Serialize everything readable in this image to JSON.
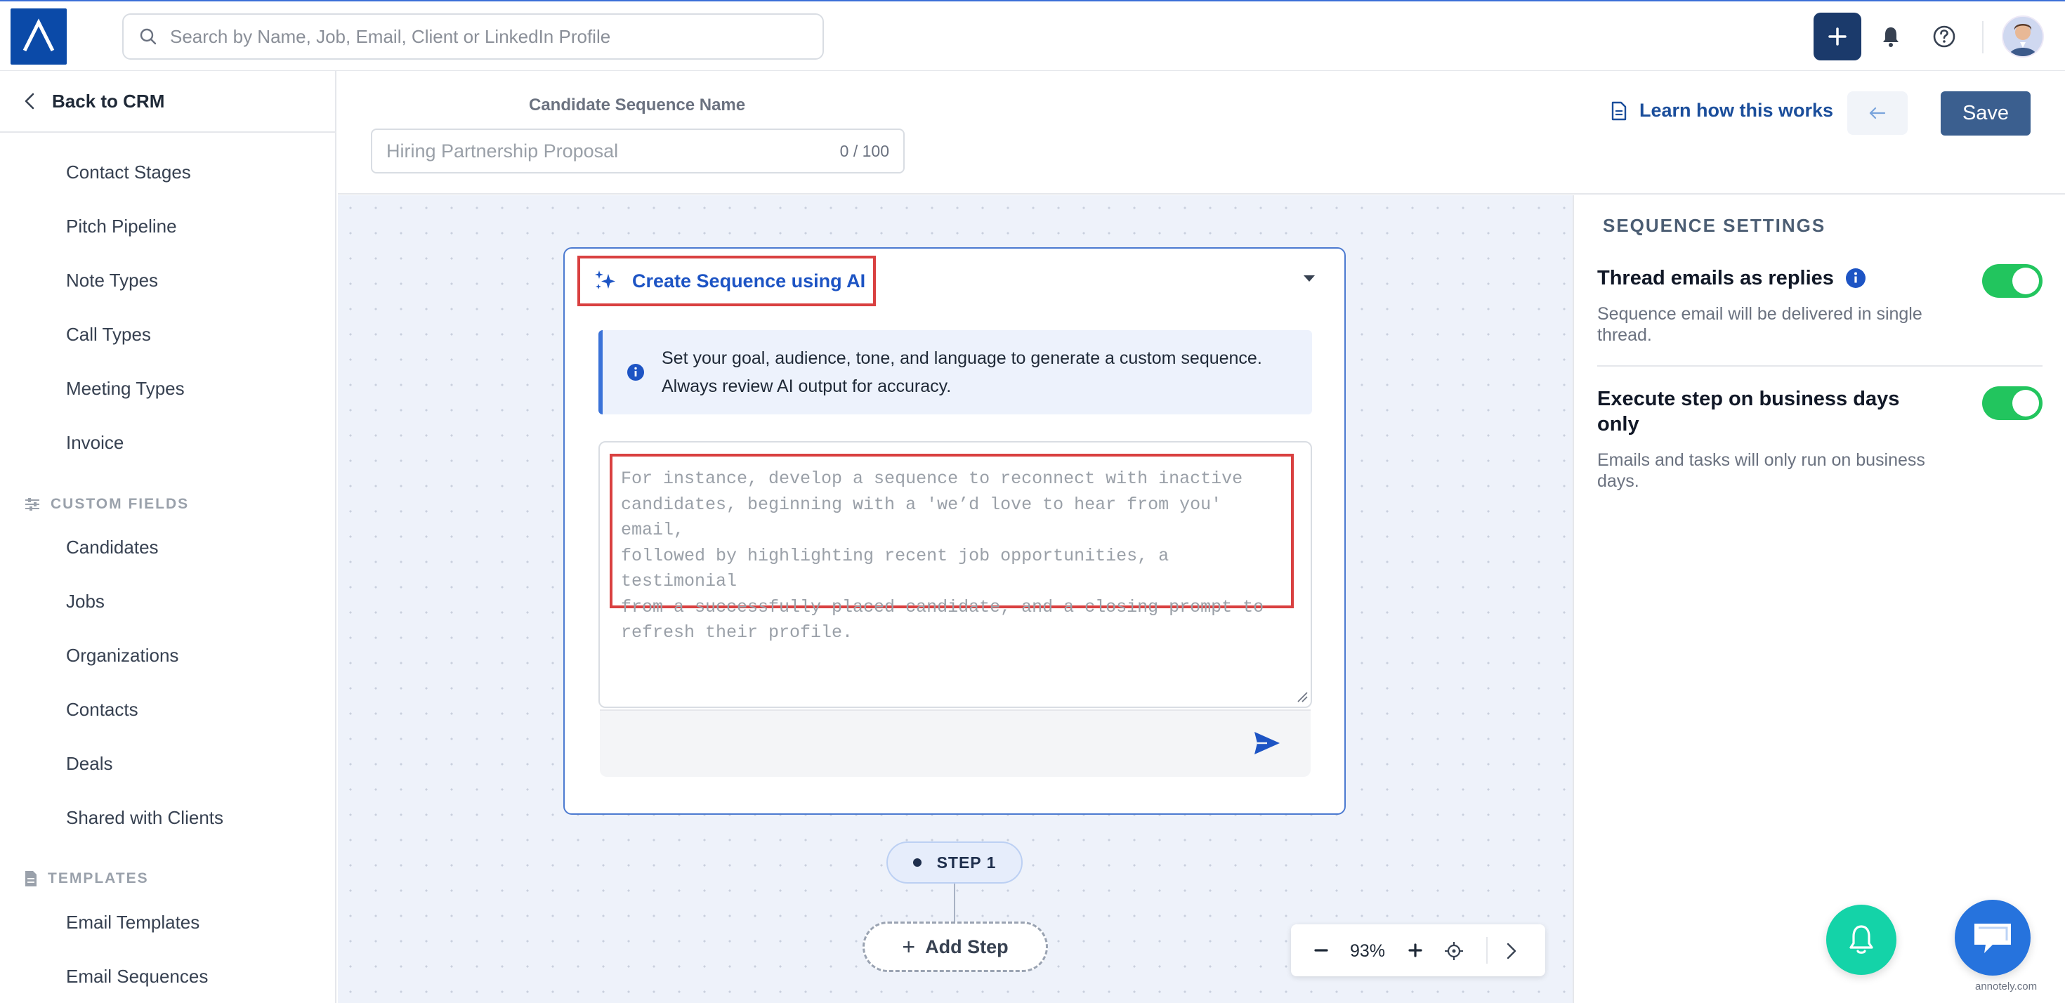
{
  "topbar": {
    "search_placeholder": "Search by Name, Job, Email, Client or LinkedIn Profile"
  },
  "sidebar": {
    "back_label": "Back to CRM",
    "items_a": [
      "Contact Stages",
      "Pitch Pipeline",
      "Note Types",
      "Call Types",
      "Meeting Types",
      "Invoice"
    ],
    "custom_fields_label": "CUSTOM FIELDS",
    "items_b": [
      "Candidates",
      "Jobs",
      "Organizations",
      "Contacts",
      "Deals",
      "Shared with Clients"
    ],
    "templates_label": "TEMPLATES",
    "items_c": [
      "Email Templates",
      "Email Sequences"
    ]
  },
  "header": {
    "sequence_name_label": "Candidate Sequence Name",
    "sequence_name_placeholder": "Hiring Partnership Proposal",
    "sequence_name_count": "0 / 100",
    "learn_label": "Learn how this works",
    "save_label": "Save"
  },
  "ai_card": {
    "title": "Create Sequence using AI",
    "info_line1": "Set your goal, audience, tone, and language to generate a custom sequence.",
    "info_line2": "Always review AI output for accuracy.",
    "prompt_placeholder_lines": [
      "For instance, develop a sequence to reconnect with inactive",
      "candidates, beginning with a 'we’d love to hear from you' email,",
      "followed by highlighting recent job opportunities, a testimonial",
      "from a successfully placed candidate, and a closing prompt to",
      "refresh their profile."
    ]
  },
  "flow": {
    "step_label": "STEP 1",
    "add_step_label": "Add Step",
    "zoom_level": "93%"
  },
  "settings": {
    "heading": "SEQUENCE SETTINGS",
    "thread_title": "Thread emails as replies",
    "thread_desc_1": "Sequence email will be delivered in single",
    "thread_desc_2": "thread.",
    "thread_enabled": true,
    "business_title_1": "Execute step on business days",
    "business_title_2": "only",
    "business_desc_1": "Emails and tasks will only run on business",
    "business_desc_2": "days.",
    "business_enabled": true
  },
  "watermark": "annotely.com",
  "colors": {
    "accent": "#1d54c4",
    "brand": "#0b4aa8",
    "toggle_on": "#22c55e",
    "highlight_box": "#d94040"
  }
}
